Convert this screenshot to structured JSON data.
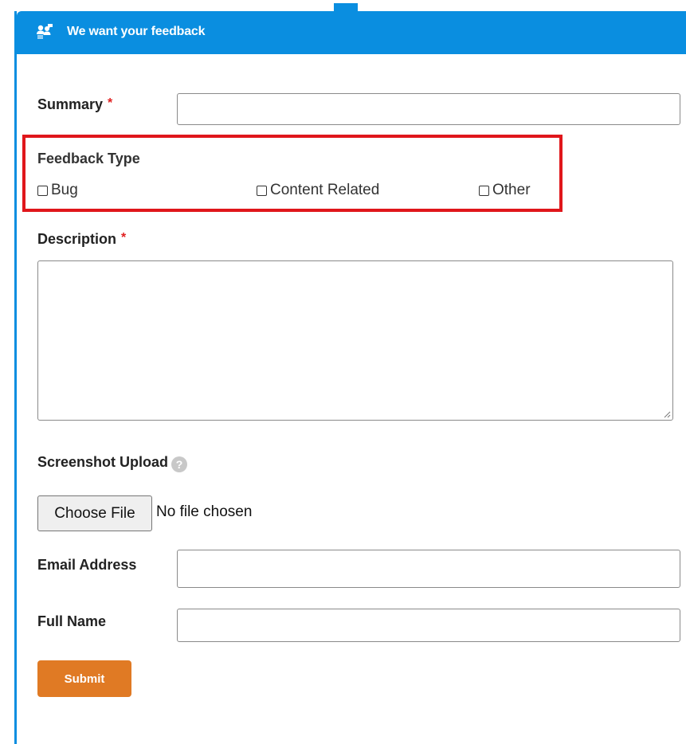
{
  "header": {
    "title": "We want your feedback",
    "icon": "users-chat-icon",
    "color": "#0a8ee0"
  },
  "form": {
    "summary": {
      "label": "Summary",
      "required_mark": "*",
      "value": ""
    },
    "feedback_type": {
      "label": "Feedback Type",
      "options": [
        {
          "label": "Bug",
          "checked": false
        },
        {
          "label": "Content Related",
          "checked": false
        },
        {
          "label": "Other",
          "checked": false
        }
      ],
      "highlight_color": "#e0161b"
    },
    "description": {
      "label": "Description",
      "required_mark": "*",
      "value": ""
    },
    "screenshot": {
      "label": "Screenshot Upload",
      "help_icon": "?",
      "button_label": "Choose File",
      "status": "No file chosen"
    },
    "email": {
      "label": "Email Address",
      "value": ""
    },
    "full_name": {
      "label": "Full Name",
      "value": ""
    },
    "submit": {
      "label": "Submit",
      "color": "#e07a24"
    }
  }
}
